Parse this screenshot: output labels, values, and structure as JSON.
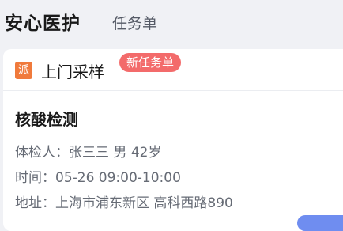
{
  "header": {
    "brand": "安心医护",
    "tab": "任务单"
  },
  "order": {
    "type_badge": "派",
    "title": "上门采样",
    "status_tag": "新任务单",
    "test_name": "核酸检测",
    "person": {
      "label": "体检人：",
      "name": "张三三",
      "gender": "男",
      "age": "42岁"
    },
    "time": {
      "label": "时间：",
      "value": "05-26 09:00-10:00"
    },
    "address": {
      "label": "地址：",
      "value": "上海市浦东新区 高科西路890"
    }
  },
  "colors": {
    "badge": "#f07a3c",
    "tag": "#f36b6b",
    "accent": "#6f8df0"
  }
}
